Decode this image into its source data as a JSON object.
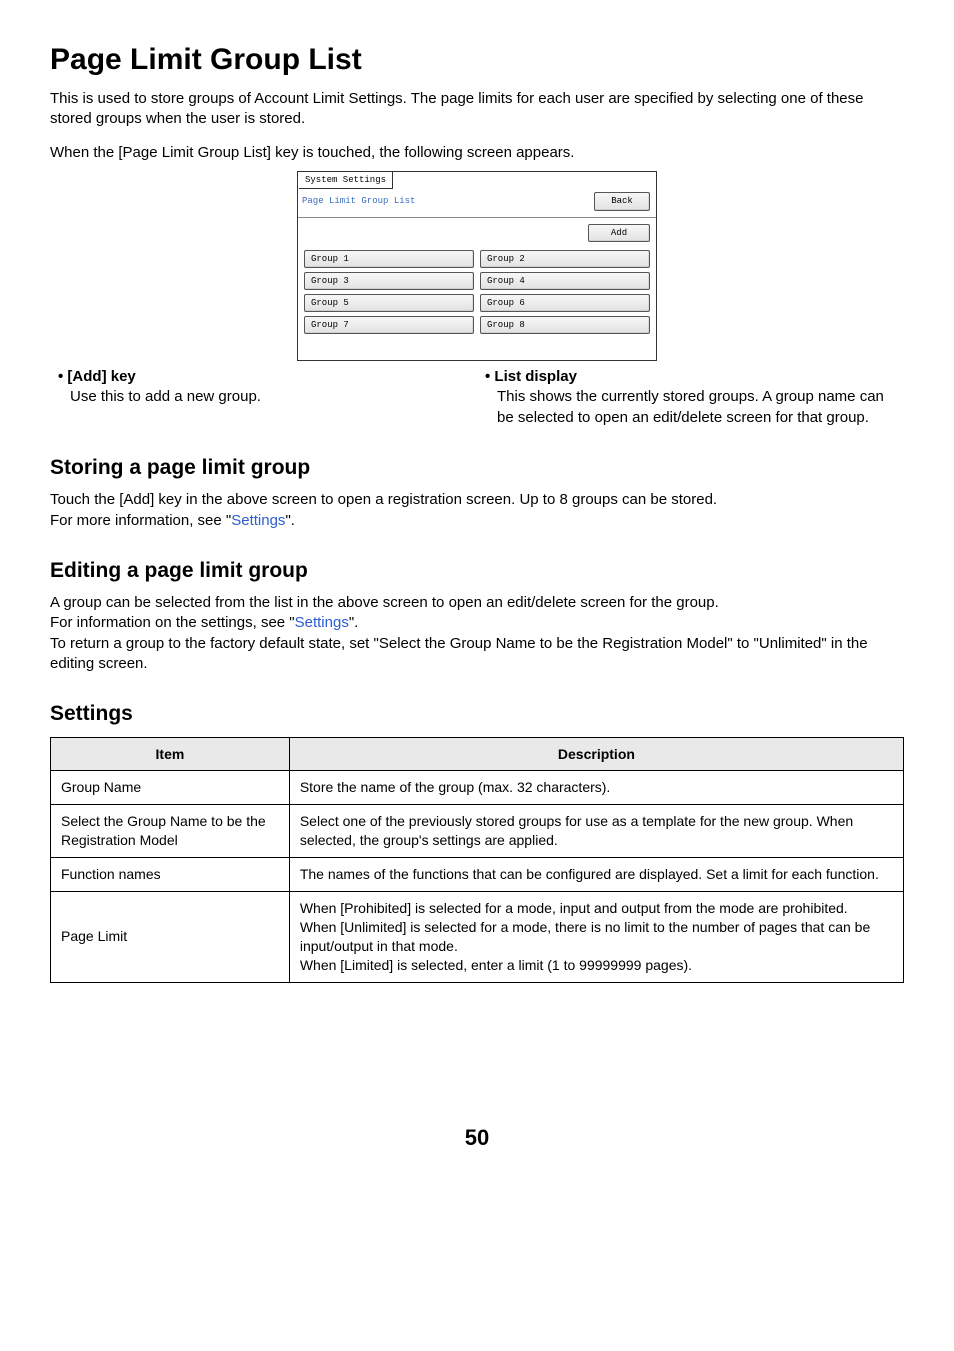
{
  "page": {
    "title": "Page Limit Group List",
    "intro_p1": "This is used to store groups of Account Limit Settings. The page limits for each user are specified by selecting one of these stored groups when the user is stored.",
    "intro_p2": "When the [Page Limit Group List] key is touched, the following screen appears.",
    "page_number": "50"
  },
  "screenshot": {
    "tab": "System Settings",
    "title": "Page Limit Group List",
    "back": "Back",
    "add": "Add",
    "groups": [
      "Group 1",
      "Group 2",
      "Group 3",
      "Group 4",
      "Group 5",
      "Group 6",
      "Group 7",
      "Group 8"
    ]
  },
  "bullets": {
    "left_head": "• [Add] key",
    "left_body": "Use this to add a new group.",
    "right_head": "• List display",
    "right_body": "This shows the currently stored groups. A group name can be selected to open an edit/delete screen for that group."
  },
  "storing": {
    "heading": "Storing a page limit group",
    "p1": "Touch the [Add] key in the above screen to open a registration screen. Up to 8 groups can be stored.",
    "p2a": "For more information, see \"",
    "p2link": "Settings",
    "p2b": "\"."
  },
  "editing": {
    "heading": "Editing a page limit group",
    "p1": "A group can be selected from the list in the above screen to open an edit/delete screen for the group.",
    "p2a": "For information on the settings, see \"",
    "p2link": "Settings",
    "p2b": "\".",
    "p3": "To return a group to the factory default state, set \"Select the Group Name to be the Registration Model\" to \"Unlimited\" in the editing screen."
  },
  "settings": {
    "heading": "Settings",
    "th_item": "Item",
    "th_desc": "Description",
    "rows": [
      {
        "item": "Group Name",
        "desc": "Store the name of the group (max. 32 characters)."
      },
      {
        "item": "Select the Group Name to be the Registration Model",
        "desc": "Select one of the previously stored groups for use as a template for the new group. When selected, the group's settings are applied."
      },
      {
        "item": "Function names",
        "desc": "The names of the functions that can be configured are displayed. Set a limit for each function."
      },
      {
        "item": "Page Limit",
        "desc": "When [Prohibited] is selected for a mode, input and output from the mode are prohibited.\nWhen [Unlimited] is selected for a mode, there is no limit to the number of pages that can be input/output in that mode.\nWhen [Limited] is selected, enter a limit (1 to 99999999 pages)."
      }
    ]
  }
}
